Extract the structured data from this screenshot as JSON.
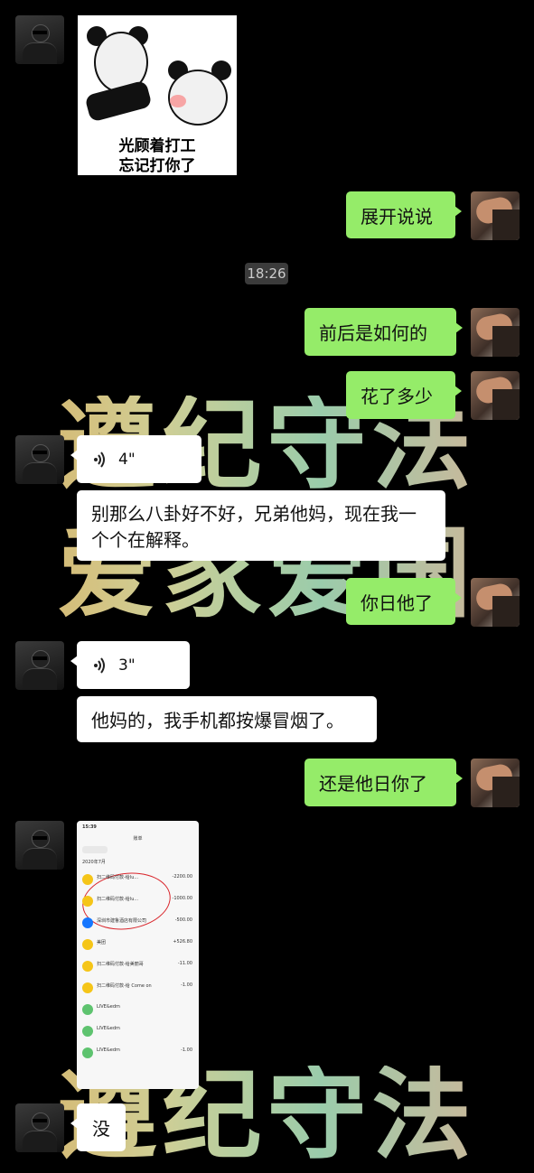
{
  "watermark": {
    "line1": "遵纪守法",
    "line2": "爱家爱国",
    "line3": "遵纪守法"
  },
  "timestamp": "18:26",
  "sticker": {
    "caption_line1": "光顾着打工",
    "caption_line2": "忘记打你了"
  },
  "messages": {
    "m1": "展开说说",
    "m2": "前后是如何的",
    "m3": "花了多少",
    "v1": "4\"",
    "m4": "别那么八卦好不好，兄弟他妈，现在我一个个在解释。",
    "m5": "你日他了",
    "v2": "3\"",
    "m6": "他妈的，我手机都按爆冒烟了。",
    "m7": "还是他日你了",
    "m8": "没"
  },
  "screenshot": {
    "time": "15:39",
    "title": "账单",
    "month": "2020年7月",
    "rows": [
      {
        "label": "扫二维码付款-给lu...",
        "amount": "-2200.00"
      },
      {
        "label": "扫二维码付款-给lu...",
        "amount": "-1000.00"
      },
      {
        "label": "深圳市建鲁酒店有限公司",
        "amount": "-500.00"
      },
      {
        "label": "美团",
        "amount": "+526.80"
      },
      {
        "label": "扫二维码付款-给美丽哥",
        "amount": "-11.00"
      },
      {
        "label": "扫二维码付款-给 Come on",
        "amount": "-1.00"
      },
      {
        "label": "LIVE&edm",
        "amount": ""
      },
      {
        "label": "LIVE&edm",
        "amount": ""
      },
      {
        "label": "LIVE&edm",
        "amount": "-1.00"
      }
    ]
  },
  "colors": {
    "green_bubble": "#95ec69",
    "white_bubble": "#ffffff",
    "background": "#000000"
  }
}
